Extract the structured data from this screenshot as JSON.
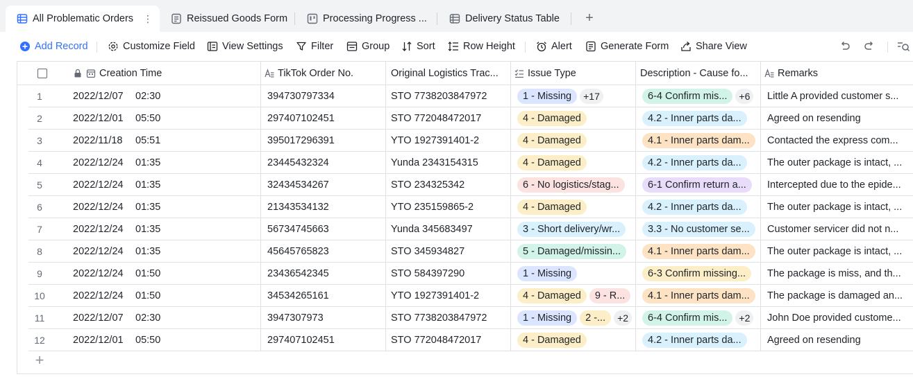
{
  "tabs": [
    {
      "label": "All Problematic Orders",
      "icon": "grid-view-icon",
      "active": true
    },
    {
      "label": "Reissued Goods Form",
      "icon": "form-view-icon"
    },
    {
      "label": "Processing Progress ...",
      "icon": "kanban-view-icon"
    },
    {
      "label": "Delivery Status Table",
      "icon": "table-view-icon"
    }
  ],
  "tab_more": "⋮",
  "tab_add": "+",
  "toolbar": {
    "add_record": "Add Record",
    "customize_field": "Customize Field",
    "view_settings": "View Settings",
    "filter": "Filter",
    "group": "Group",
    "sort": "Sort",
    "row_height": "Row Height",
    "alert": "Alert",
    "generate_form": "Generate Form",
    "share_view": "Share View"
  },
  "columns": {
    "creation_time": "Creation Time",
    "order_no": "TikTok Order No.",
    "logistics": "Original Logistics Trac...",
    "issue_type": "Issue Type",
    "description": "Description - Cause fo...",
    "remarks": "Remarks"
  },
  "rows": [
    {
      "num": "1",
      "date": "2022/12/07",
      "time": "02:30",
      "order": "394730797334",
      "logistics": "STO 7738203847972",
      "issues": [
        {
          "t": "1 - Missing",
          "c": "blue"
        }
      ],
      "issues_more": "+17",
      "desc": [
        {
          "t": "6-4 Confirm mis...",
          "c": "teal"
        }
      ],
      "desc_more": "+6",
      "remark": "Little A provided customer s..."
    },
    {
      "num": "2",
      "date": "2022/12/01",
      "time": "05:50",
      "order": "297407102451",
      "logistics": "STO 772048472017",
      "issues": [
        {
          "t": "4 - Damaged",
          "c": "yellow"
        }
      ],
      "desc": [
        {
          "t": "4.2 - Inner parts da...",
          "c": "sky"
        }
      ],
      "remark": "Agreed on resending"
    },
    {
      "num": "3",
      "date": "2022/11/18",
      "time": "05:51",
      "order": "395017296391",
      "logistics": "YTO 1927391401-2",
      "issues": [
        {
          "t": "4 - Damaged",
          "c": "yellow"
        }
      ],
      "desc": [
        {
          "t": "4.1 - Inner parts dam...",
          "c": "orange"
        }
      ],
      "remark": "Contacted the express com..."
    },
    {
      "num": "4",
      "date": "2022/12/24",
      "time": "01:35",
      "order": "23445432324",
      "logistics": "Yunda 2343154315",
      "issues": [
        {
          "t": "4 - Damaged",
          "c": "yellow"
        }
      ],
      "desc": [
        {
          "t": "4.2 - Inner parts da...",
          "c": "sky"
        }
      ],
      "remark": "The outer package is intact, ..."
    },
    {
      "num": "5",
      "date": "2022/12/24",
      "time": "01:35",
      "order": "32434534267",
      "logistics": "STO 234325342",
      "issues": [
        {
          "t": "6 - No logistics/stag...",
          "c": "pink"
        }
      ],
      "desc": [
        {
          "t": "6-1 Confirm return a...",
          "c": "purple"
        }
      ],
      "remark": "Intercepted due to the epide..."
    },
    {
      "num": "6",
      "date": "2022/12/24",
      "time": "01:35",
      "order": "21343534132",
      "logistics": "YTO 235159865-2",
      "issues": [
        {
          "t": "4 - Damaged",
          "c": "yellow"
        }
      ],
      "desc": [
        {
          "t": "4.2 - Inner parts da...",
          "c": "sky"
        }
      ],
      "remark": "The outer package is intact, ..."
    },
    {
      "num": "7",
      "date": "2022/12/24",
      "time": "01:35",
      "order": "56734745663",
      "logistics": "Yunda 345683497",
      "issues": [
        {
          "t": "3 - Short delivery/wr...",
          "c": "sky"
        }
      ],
      "desc": [
        {
          "t": "3.3 - No customer se...",
          "c": "sky"
        }
      ],
      "remark": "Customer servicer did not n..."
    },
    {
      "num": "8",
      "date": "2022/12/24",
      "time": "01:35",
      "order": "45645765823",
      "logistics": "STO 345934827",
      "issues": [
        {
          "t": "5 - Damaged/missin...",
          "c": "teal"
        }
      ],
      "desc": [
        {
          "t": "4.1 - Inner parts dam...",
          "c": "orange"
        }
      ],
      "remark": "The outer package is intact, ..."
    },
    {
      "num": "9",
      "date": "2022/12/24",
      "time": "01:50",
      "order": "23436542345",
      "logistics": "STO 584397290",
      "issues": [
        {
          "t": "1 - Missing",
          "c": "blue"
        }
      ],
      "desc": [
        {
          "t": "6-3 Confirm missing...",
          "c": "yellow"
        }
      ],
      "remark": "The package is miss, and th..."
    },
    {
      "num": "10",
      "date": "2022/12/24",
      "time": "01:50",
      "order": "34534265161",
      "logistics": "YTO 1927391401-2",
      "issues": [
        {
          "t": "4 - Damaged",
          "c": "yellow"
        },
        {
          "t": "9 - R...",
          "c": "pink"
        }
      ],
      "desc": [
        {
          "t": "4.1 - Inner parts dam...",
          "c": "orange"
        }
      ],
      "remark": "The package is damaged an..."
    },
    {
      "num": "11",
      "date": "2022/12/07",
      "time": "02:30",
      "order": "3947307973",
      "logistics": "STO 7738203847972",
      "issues": [
        {
          "t": "1 - Missing",
          "c": "blue"
        },
        {
          "t": "2 -...",
          "c": "yellow"
        }
      ],
      "issues_more": "+2",
      "desc": [
        {
          "t": "6-4 Confirm mis...",
          "c": "teal"
        }
      ],
      "desc_more": "+2",
      "remark": "John Doe provided custome..."
    },
    {
      "num": "12",
      "date": "2022/12/01",
      "time": "05:50",
      "order": "297407102451",
      "logistics": "STO 772048472017",
      "issues": [
        {
          "t": "4 - Damaged",
          "c": "yellow"
        }
      ],
      "desc": [
        {
          "t": "4.2 - Inner parts da...",
          "c": "sky"
        }
      ],
      "remark": "Agreed on resending"
    }
  ],
  "add_row": "+",
  "colors": {
    "accent": "#3370ff",
    "blue": "#dbe5ff",
    "yellow": "#fcefc7",
    "sky": "#d9f1fc",
    "orange": "#fde3c4",
    "pink": "#fde2e2",
    "purple": "#e8dcfa",
    "teal": "#d2f4e8"
  }
}
